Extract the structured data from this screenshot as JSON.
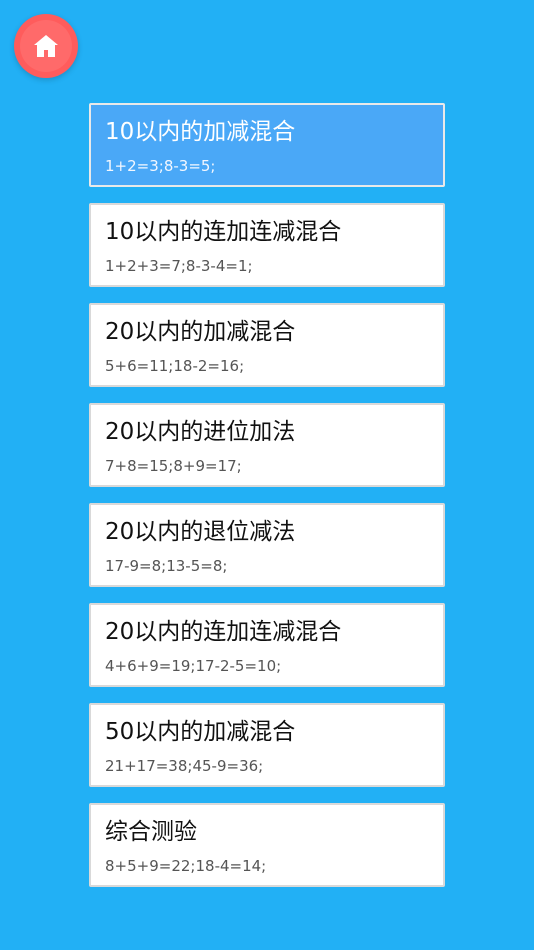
{
  "header": {
    "home_icon": "home-icon"
  },
  "lessons": [
    {
      "title": "10以内的加减混合",
      "desc": "1+2=3;8-3=5;"
    },
    {
      "title": "10以内的连加连减混合",
      "desc": "1+2+3=7;8-3-4=1;"
    },
    {
      "title": "20以内的加减混合",
      "desc": "5+6=11;18-2=16;"
    },
    {
      "title": "20以内的进位加法",
      "desc": "7+8=15;8+9=17;"
    },
    {
      "title": "20以内的退位减法",
      "desc": "17-9=8;13-5=8;"
    },
    {
      "title": "20以内的连加连减混合",
      "desc": "4+6+9=19;17-2-5=10;"
    },
    {
      "title": "50以内的加减混合",
      "desc": "21+17=38;45-9=36;"
    },
    {
      "title": "综合测验",
      "desc": "8+5+9=22;18-4=14;"
    }
  ],
  "colors": {
    "background": "#22b0f5",
    "selected_card": "#4aa8f7",
    "card": "#ffffff",
    "home_button": "#ff5c5c"
  }
}
